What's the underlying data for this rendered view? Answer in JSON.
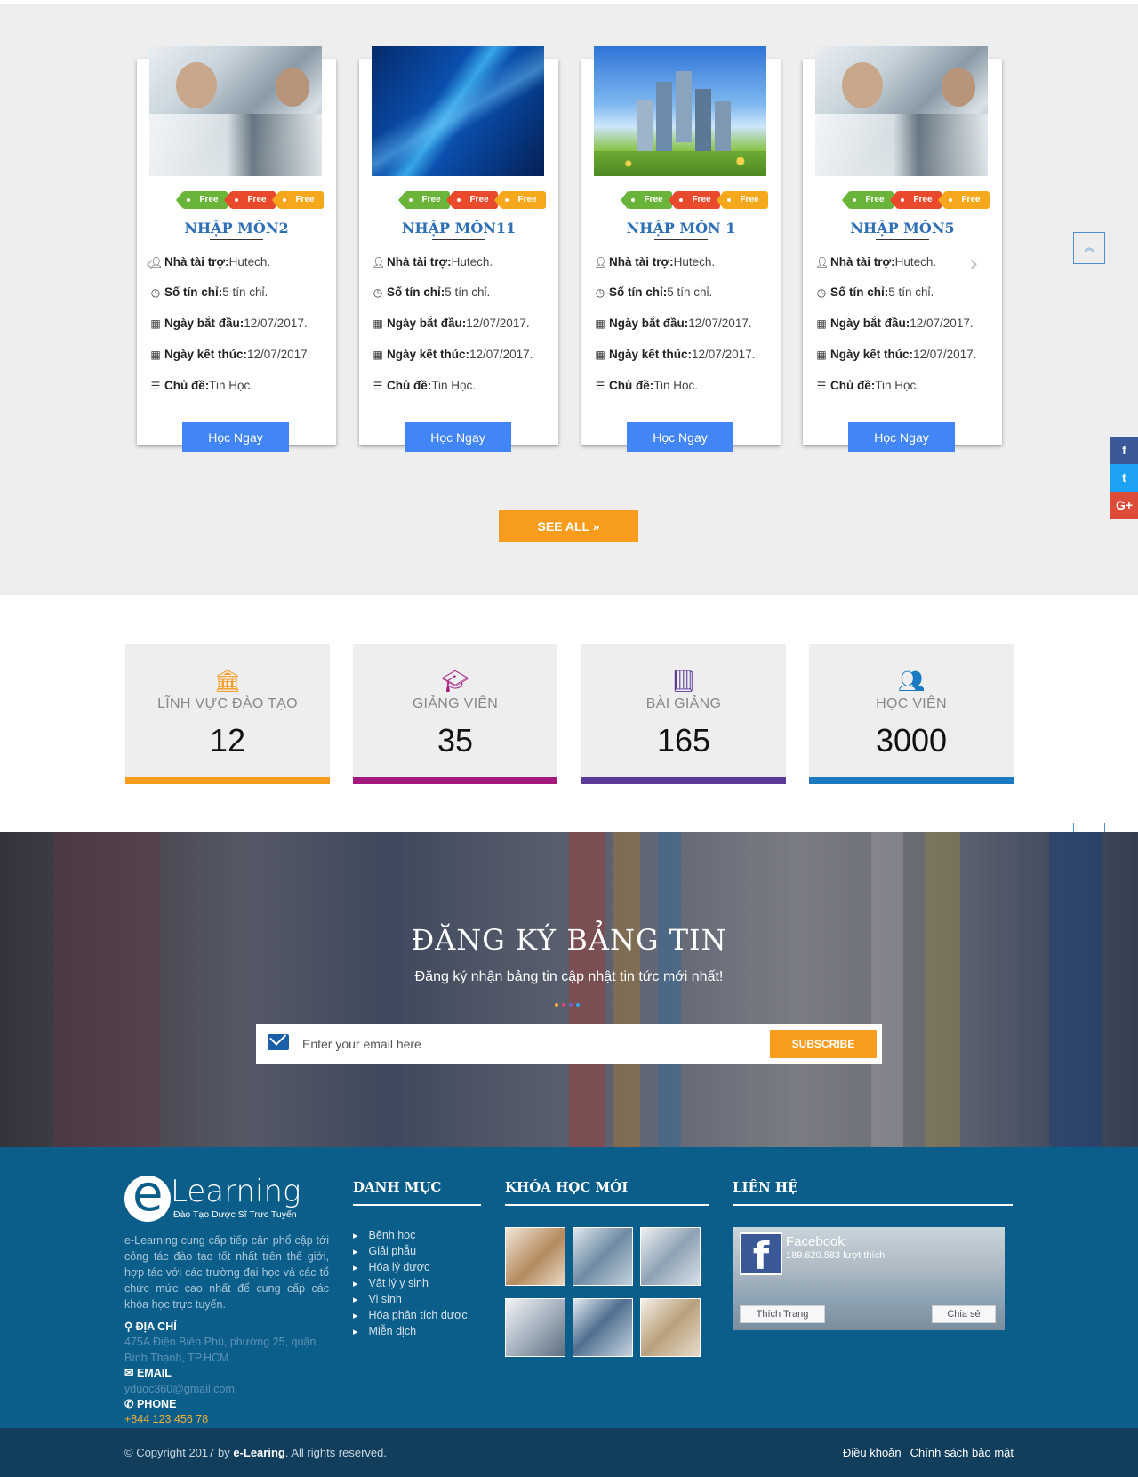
{
  "courses": {
    "cards": [
      {
        "title": "NHẬP MÔN2",
        "image": "lab-photo",
        "tags": [
          "Free",
          "Free",
          "Free"
        ],
        "sponsor_label": "Nhà tài trợ:",
        "sponsor": " Hutech.",
        "credits_label": "Số tín chỉ:",
        "credits": " 5 tín chỉ.",
        "start_label": "Ngày bắt đầu:",
        "start": "12/07/2017.",
        "end_label": "Ngày kết thúc:",
        "end": "12/07/2017.",
        "topic_label": "Chủ đề:",
        "topic": "Tin Học.",
        "button": "Học Ngay"
      },
      {
        "title": "NHẬP MÔN11",
        "image": "blue-abstract",
        "tags": [
          "Free",
          "Free",
          "Free"
        ],
        "sponsor_label": "Nhà tài trợ:",
        "sponsor": " Hutech.",
        "credits_label": "Số tín chỉ:",
        "credits": " 5 tín chỉ.",
        "start_label": "Ngày bắt đầu:",
        "start": "12/07/2017.",
        "end_label": "Ngày kết thúc:",
        "end": "12/07/2017.",
        "topic_label": "Chủ đề:",
        "topic": "Tin Học.",
        "button": "Học Ngay"
      },
      {
        "title": "NHẬP MÔN 1",
        "image": "city-skyline",
        "tags": [
          "Free",
          "Free",
          "Free"
        ],
        "sponsor_label": "Nhà tài trợ:",
        "sponsor": " Hutech.",
        "credits_label": "Số tín chỉ:",
        "credits": " 5 tín chỉ.",
        "start_label": "Ngày bắt đầu:",
        "start": "12/07/2017.",
        "end_label": "Ngày kết thúc:",
        "end": "12/07/2017.",
        "topic_label": "Chủ đề:",
        "topic": "Tin Học.",
        "button": "Học Ngay"
      },
      {
        "title": "NHẬP MÔN5",
        "image": "lab-photo",
        "tags": [
          "Free",
          "Free",
          "Free"
        ],
        "sponsor_label": "Nhà tài trợ:",
        "sponsor": " Hutech.",
        "credits_label": "Số tín chỉ:",
        "credits": " 5 tín chỉ.",
        "start_label": "Ngày bắt đầu:",
        "start": "12/07/2017.",
        "end_label": "Ngày kết thúc:",
        "end": "12/07/2017.",
        "topic_label": "Chủ đề:",
        "topic": "Tin Học.",
        "button": "Học Ngay"
      }
    ],
    "see_all": "SEE ALL »",
    "prev_arrow": "‹",
    "next_arrow": "›"
  },
  "stats": [
    {
      "label": "LĨNH VỰC ĐÀO TẠO",
      "value": "12",
      "icon": "institution-icon",
      "color": "#f79c1c"
    },
    {
      "label": "GIẢNG VIÊN",
      "value": "35",
      "icon": "graduation-cap-icon",
      "color": "#a3197e"
    },
    {
      "label": "BÀI GIẢNG",
      "value": "165",
      "icon": "book-icon",
      "color": "#5b3a9a"
    },
    {
      "label": "HỌC VIÊN",
      "value": "3000",
      "icon": "users-icon",
      "color": "#1a7bc0"
    }
  ],
  "newsletter": {
    "title": "ĐĂNG KÝ BẢNG TIN",
    "subtitle": "Đăng ký nhận bảng tin cập nhật tin tức mới nhất!",
    "placeholder": "Enter your email here",
    "button": "SUBSCRIBE"
  },
  "footer": {
    "logo_text": "Learning",
    "logo_tagline": "Đào Tạo Dược Sĩ Trực Tuyến",
    "description": "e-Learning cung cấp tiếp cận phổ cập tới công tác đào tạo tốt nhất trên thế giới, hợp tác với các trường đại học và các tổ chức mức cao nhất để cung cấp các khóa học trực tuyến.",
    "address_label": "ĐỊA CHỈ",
    "address": "475A Điện Biên Phủ, phường 25, quận Bình Thạnh, TP.HCM",
    "email_label": "EMAIL",
    "email": "yduoc360@gmail.com",
    "phone_label": "PHONE",
    "phone": "+844 123 456 78",
    "categories_title": "DANH MỤC",
    "categories": [
      "Bệnh học",
      "Giải phẫu",
      "Hóa lý dược",
      "Vật lý y sinh",
      "Vi sinh",
      "Hóa phân tích dược",
      "Miễn dịch"
    ],
    "new_courses_title": "KHÓA HỌC MỚI",
    "contact_title": "LIÊN HỆ",
    "facebook": {
      "name": "Facebook",
      "likes": "189.620.583 lượt thích",
      "like_button": "Thích Trang",
      "share_button": "Chia sẻ"
    }
  },
  "bottom": {
    "copyright_prefix": "© Copyright 2017 by ",
    "copyright_brand": "e-Learing",
    "copyright_suffix": ". All rights reserved.",
    "terms": "Điều khoản",
    "privacy": "Chính sách bảo mật"
  },
  "social": {
    "facebook": "f",
    "twitter": "t",
    "google_plus": "G+"
  }
}
